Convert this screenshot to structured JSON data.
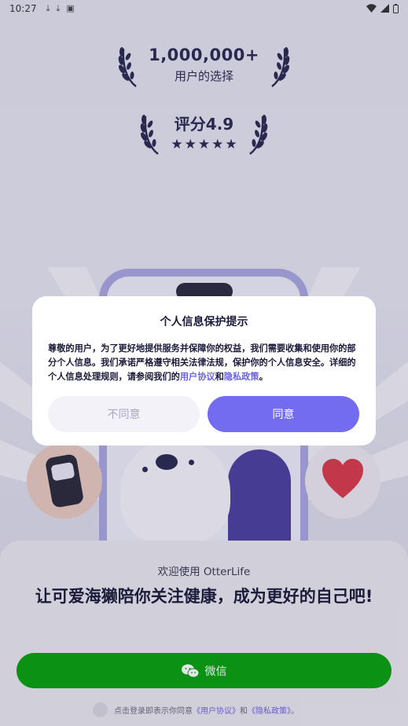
{
  "status_bar": {
    "time": "10:27",
    "left_icons": [
      "download-icon",
      "download-icon",
      "notification-icon"
    ],
    "right_icons": [
      "wifi-icon",
      "signal-icon",
      "battery-icon"
    ]
  },
  "awards": {
    "users_count": "1,000,000+",
    "users_caption": "用户的选择",
    "rating_label": "评分4.9",
    "stars": 5
  },
  "dialog": {
    "title": "个人信息保护提示",
    "body_prefix": "尊敬的用户，为了更好地提供服务并保障你的权益，我们需要收集和使用你的部分个人信息。我们承诺严格遵守相关法律法规，保护你的个人信息安全。详细的个人信息处理规则，请参阅我们的",
    "user_agreement_link": "用户协议",
    "and_text": "和",
    "privacy_link": "隐私政策",
    "body_suffix": "。",
    "disagree_label": "不同意",
    "agree_label": "同意"
  },
  "sheet": {
    "welcome": "欢迎使用 OtterLife",
    "slogan": "让可爱海獭陪你关注健康，成为更好的自己吧!",
    "wechat_label": "微信",
    "consent_prefix": "点击登录即表示你同意",
    "consent_user_agreement": "《用户协议》",
    "consent_and": "和",
    "consent_privacy": "《隐私政策》",
    "consent_suffix": "。"
  },
  "colors": {
    "accent": "#736cf0",
    "link": "#6b63e0",
    "wechat_green": "#07a10e",
    "heart_red": "#d9394a"
  }
}
